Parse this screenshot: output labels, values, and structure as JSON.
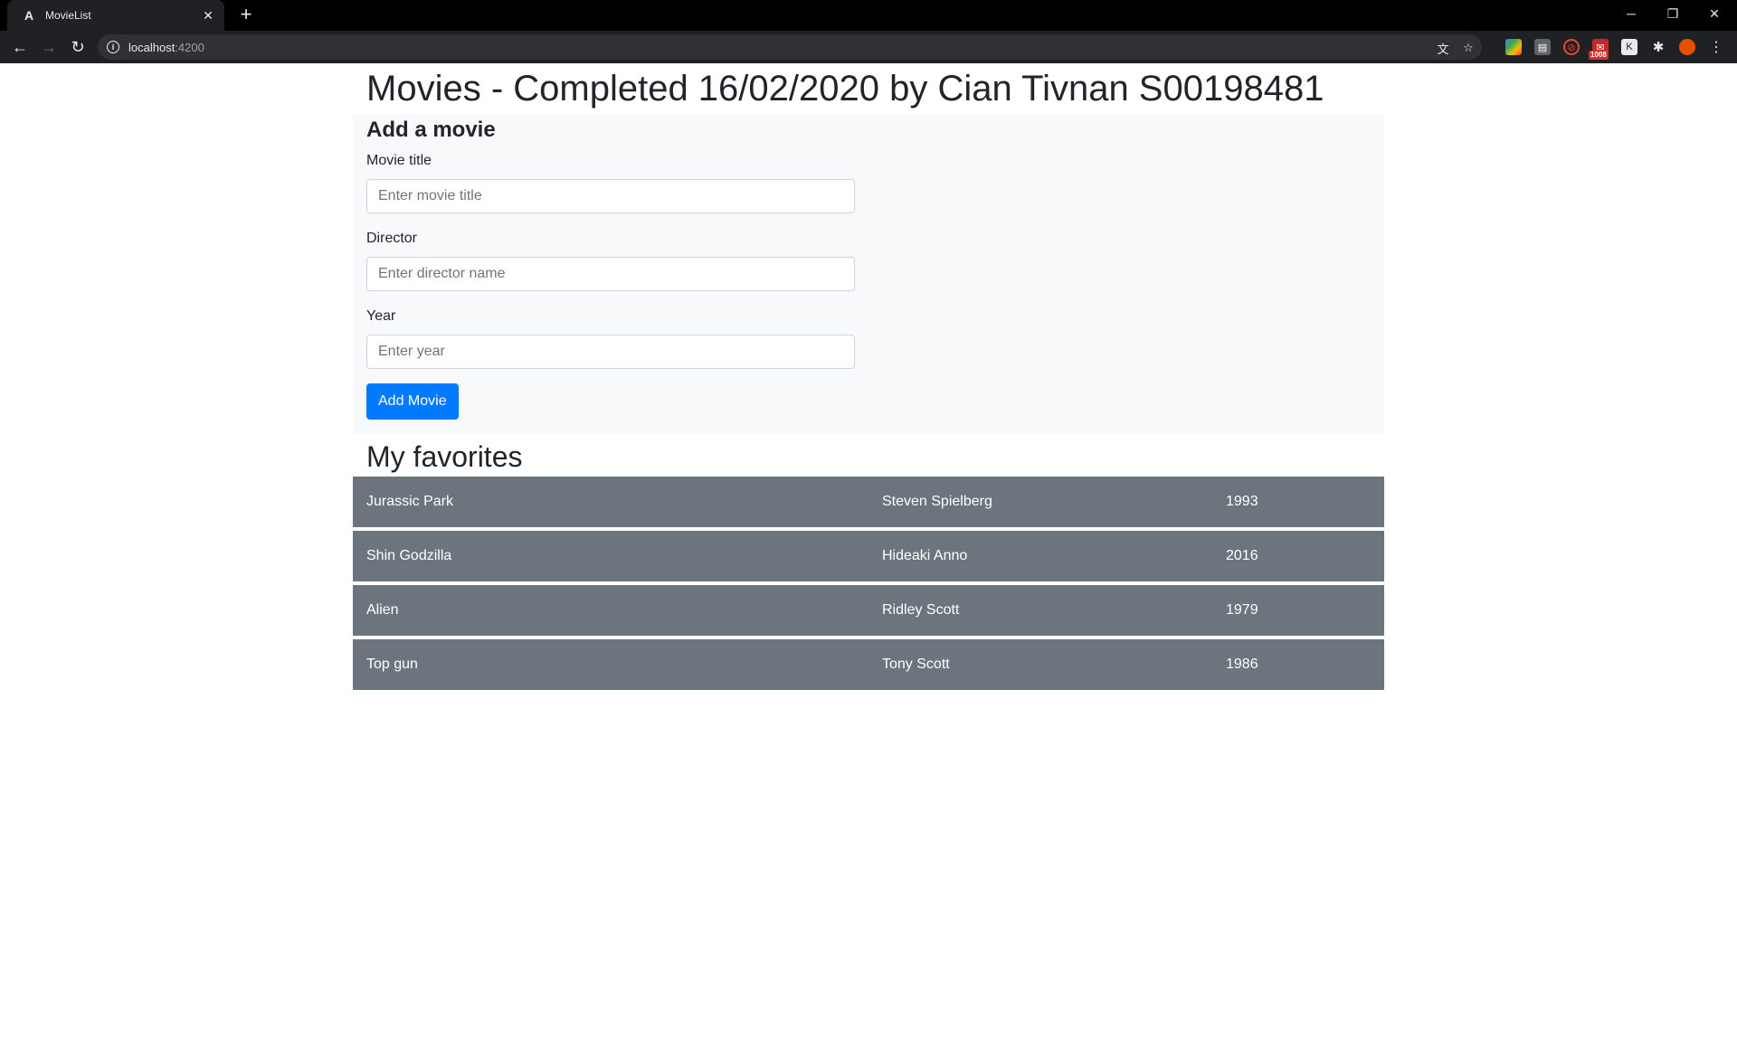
{
  "browser": {
    "tab_title": "MovieList",
    "tab_favicon": "A",
    "url_host": "localhost",
    "url_port": ":4200",
    "extension_badge": "1008"
  },
  "page": {
    "title": "Movies - Completed 16/02/2020 by Cian Tivnan S00198481"
  },
  "form": {
    "heading": "Add a movie",
    "title_label": "Movie title",
    "title_placeholder": "Enter movie title",
    "director_label": "Director",
    "director_placeholder": "Enter director name",
    "year_label": "Year",
    "year_placeholder": "Enter year",
    "submit_label": "Add Movie"
  },
  "favorites": {
    "heading": "My favorites",
    "movies": [
      {
        "title": "Jurassic Park",
        "director": "Steven Spielberg",
        "year": "1993"
      },
      {
        "title": "Shin Godzilla",
        "director": "Hideaki Anno",
        "year": "2016"
      },
      {
        "title": "Alien",
        "director": "Ridley Scott",
        "year": "1979"
      },
      {
        "title": "Top gun",
        "director": "Tony Scott",
        "year": "1986"
      }
    ]
  },
  "colors": {
    "primary": "#007bff",
    "row_bg": "#6c757d",
    "card_bg": "#f8f9fa"
  }
}
